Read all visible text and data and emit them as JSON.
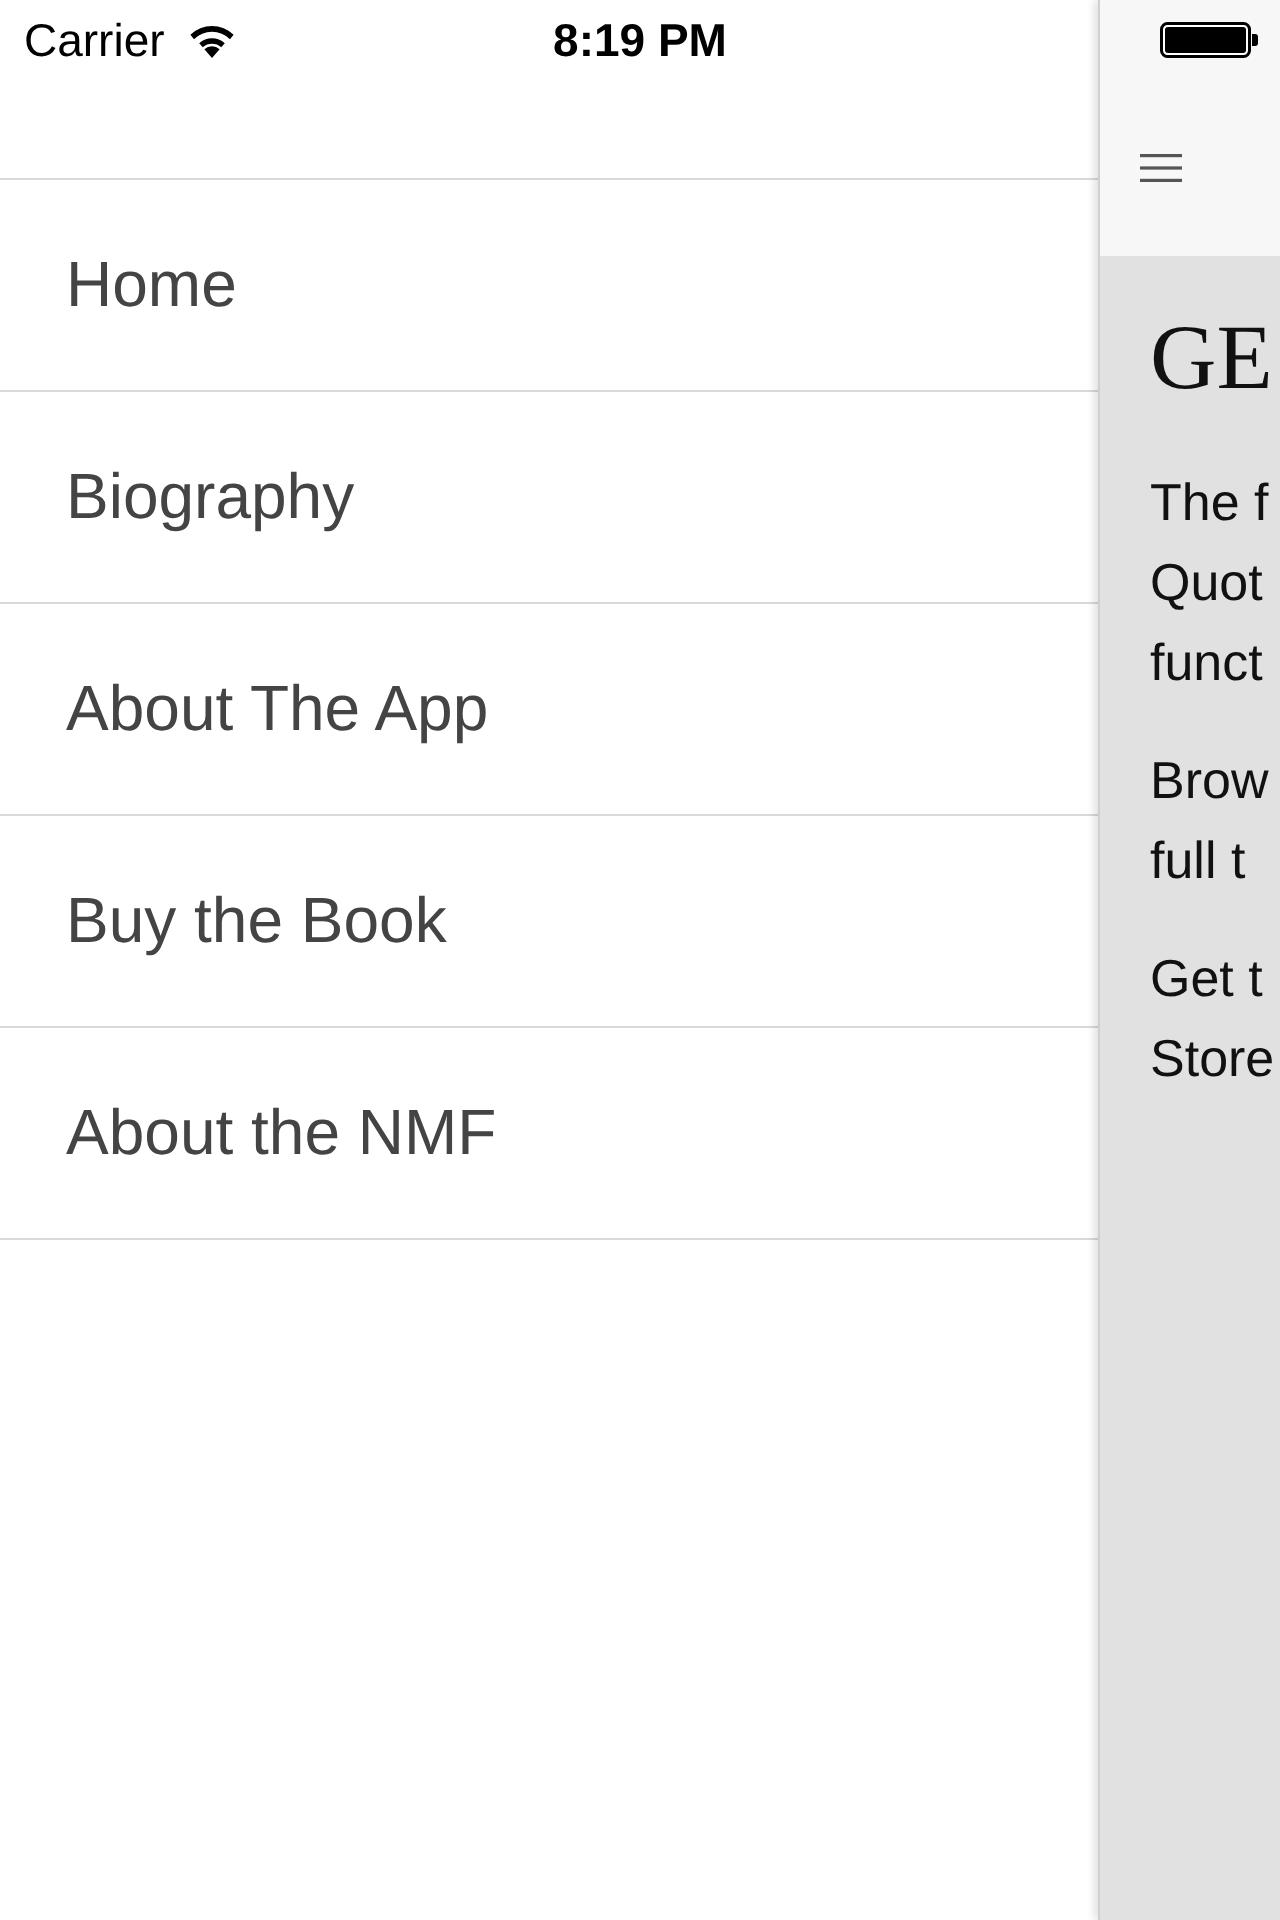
{
  "status_bar": {
    "carrier": "Carrier",
    "time": "8:19 PM"
  },
  "menu": {
    "items": [
      {
        "label": "Home"
      },
      {
        "label": "Biography"
      },
      {
        "label": "About The App"
      },
      {
        "label": "Buy the Book"
      },
      {
        "label": "About the NMF"
      }
    ]
  },
  "content": {
    "title": "GE",
    "paragraphs": [
      {
        "lines": [
          "The f",
          "Quot",
          "funct"
        ]
      },
      {
        "lines": [
          "Brow",
          "full t"
        ]
      },
      {
        "lines": [
          "Get t",
          "Store"
        ]
      }
    ]
  }
}
